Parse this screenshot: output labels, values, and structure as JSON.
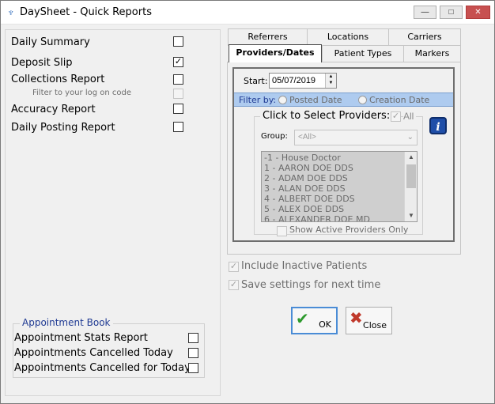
{
  "window": {
    "title": "DaySheet - Quick Reports",
    "controls": {
      "minimize": "—",
      "maximize": "□",
      "close": "✕"
    }
  },
  "reports": {
    "daily_summary": {
      "label": "Daily Summary",
      "checked": false
    },
    "deposit_slip": {
      "label": "Deposit Slip",
      "checked": true
    },
    "collections_report": {
      "label": "Collections Report",
      "checked": false
    },
    "filter_logon": {
      "label": "Filter to your log on code",
      "checked": false,
      "disabled": true
    },
    "accuracy_report": {
      "label": "Accuracy Report",
      "checked": false
    },
    "daily_posting_report": {
      "label": "Daily Posting Report",
      "checked": false
    }
  },
  "appointment_book": {
    "title": "Appointment Book",
    "items": [
      {
        "label": "Appointment Stats Report",
        "checked": false
      },
      {
        "label": "Appointments Cancelled Today",
        "checked": false
      },
      {
        "label": "Appointments Cancelled for Today",
        "checked": false
      }
    ]
  },
  "tabs": {
    "row1": [
      "Referrers",
      "Locations",
      "Carriers"
    ],
    "row2": [
      "Providers/Dates",
      "Patient Types",
      "Markers"
    ],
    "active": "Providers/Dates"
  },
  "providers_dates": {
    "start_label": "Start:",
    "start_value": "05/07/2019",
    "filter_by_label": "Filter by:",
    "posted_date_label": "Posted Date",
    "creation_date_label": "Creation Date",
    "click_to_select_label": "Click to Select Providers:",
    "all_label": "All",
    "group_label": "Group:",
    "group_value": "<All>",
    "providers": [
      "-1 - House Doctor",
      "1 - AARON DOE DDS",
      "2 - ADAM DOE DDS",
      "3 - ALAN DOE DDS",
      "4 - ALBERT DOE DDS",
      "5 - ALEX DOE DDS",
      "6 - ALEXANDER DOE MD"
    ],
    "show_active_label": "Show Active Providers Only",
    "info_icon": "info-icon"
  },
  "options": {
    "include_inactive": {
      "label": "Include Inactive Patients",
      "checked": true
    },
    "save_settings": {
      "label": "Save settings for next time",
      "checked": true
    }
  },
  "buttons": {
    "ok": "OK",
    "close": "Close"
  }
}
